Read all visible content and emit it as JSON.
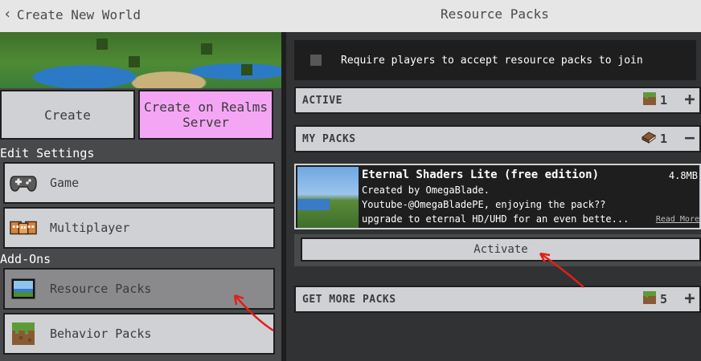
{
  "topbar": {
    "back_label": "Create New World",
    "title": "Resource Packs"
  },
  "left_panel": {
    "create_button": "Create",
    "realms_button": "Create on Realms Server",
    "edit_settings_label": "Edit Settings",
    "addons_label": "Add-Ons",
    "items": [
      {
        "label": "Game",
        "icon": "controller-icon",
        "selected": false
      },
      {
        "label": "Multiplayer",
        "icon": "multiplayer-icon",
        "selected": false
      },
      {
        "label": "Resource Packs",
        "icon": "resource-pack-icon",
        "selected": true
      },
      {
        "label": "Behavior Packs",
        "icon": "grass-block-icon",
        "selected": false
      }
    ]
  },
  "right_panel": {
    "require_label": "Require players to accept resource packs to join",
    "active": {
      "label": "ACTIVE",
      "count": "1",
      "sign": "+"
    },
    "my_packs": {
      "label": "MY PACKS",
      "count": "1",
      "sign": "−"
    },
    "pack": {
      "title": "Eternal Shaders Lite  (free edition)",
      "size": "4.8MB",
      "desc_line1": "Created by OmegaBlade.",
      "desc_line2": "Youtube-@OmegaBladePE, enjoying the pack??",
      "desc_line3": "upgrade to eternal HD/UHD for an even bette...",
      "read_more": "Read More"
    },
    "activate_label": "Activate",
    "get_more": {
      "label": "GET MORE PACKS",
      "count": "5",
      "sign": "+"
    }
  },
  "colors": {
    "background": "#313233",
    "button": "#d0d1d4",
    "realms": "#f4a6f4",
    "annotation": "#e0201c"
  }
}
